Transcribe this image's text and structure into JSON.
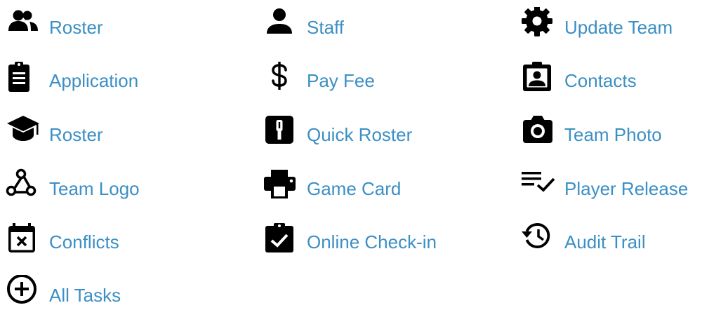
{
  "theme": {
    "link_color": "#3b8fc4",
    "icon_color": "#000000"
  },
  "tasks": [
    {
      "label": "Roster",
      "icon": "people-group-icon"
    },
    {
      "label": "Staff",
      "icon": "person-icon"
    },
    {
      "label": "Update Team",
      "icon": "gear-icon"
    },
    {
      "label": "Application",
      "icon": "clipboard-list-icon"
    },
    {
      "label": "Pay Fee",
      "icon": "dollar-sign-icon"
    },
    {
      "label": "Contacts",
      "icon": "contact-badge-icon"
    },
    {
      "label": "Roster",
      "icon": "graduation-cap-icon"
    },
    {
      "label": "Quick Roster",
      "icon": "quick-roster-icon"
    },
    {
      "label": "Team Photo",
      "icon": "camera-icon"
    },
    {
      "label": "Team Logo",
      "icon": "webhook-logo-icon"
    },
    {
      "label": "Game Card",
      "icon": "printer-icon"
    },
    {
      "label": "Player Release",
      "icon": "list-check-icon"
    },
    {
      "label": "Conflicts",
      "icon": "calendar-x-icon"
    },
    {
      "label": "Online Check-in",
      "icon": "clipboard-check-icon"
    },
    {
      "label": "Audit Trail",
      "icon": "history-icon"
    },
    {
      "label": "All Tasks",
      "icon": "plus-circle-icon"
    }
  ]
}
